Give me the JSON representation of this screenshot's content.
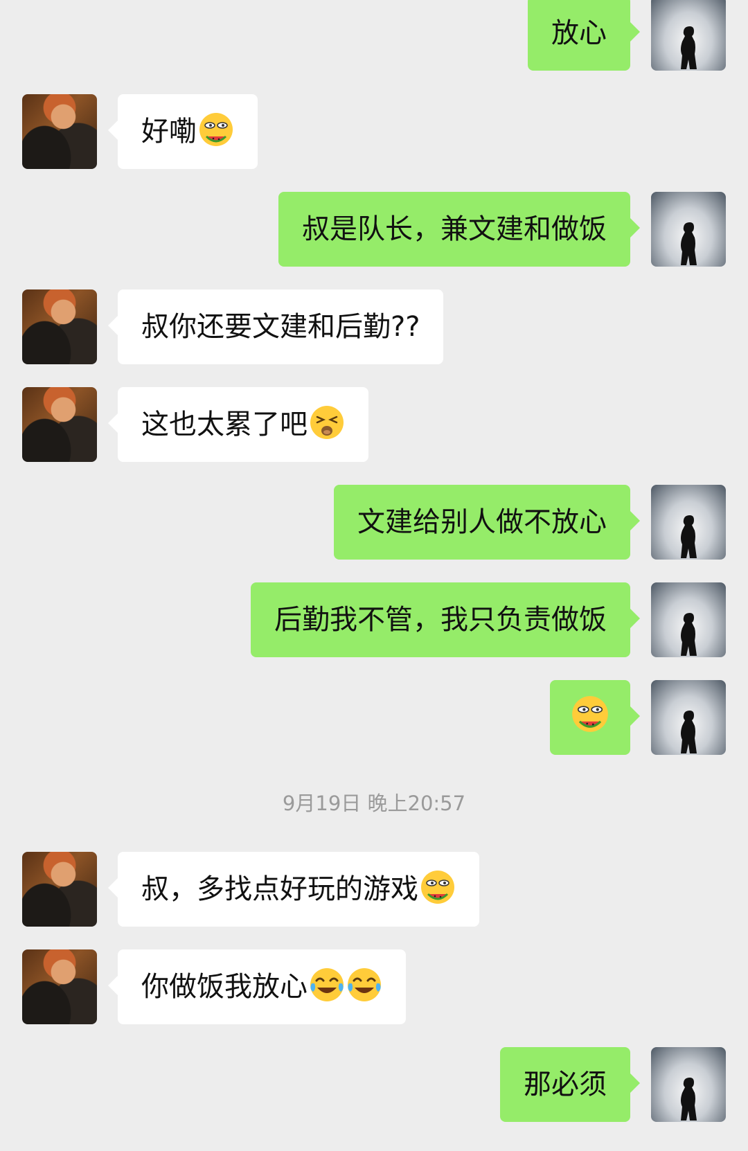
{
  "app": "WeChat chat",
  "colors": {
    "background": "#ededed",
    "self_bubble": "#95ec69",
    "friend_bubble": "#ffffff",
    "timestamp_text": "#9a9a9a"
  },
  "timestamp": "9月19日 晚上20:57",
  "messages": [
    {
      "sender": "self",
      "text": "放心",
      "emojis": []
    },
    {
      "sender": "friend",
      "text": "好嘞",
      "emojis": [
        "watermelon-eating-face-emoji"
      ]
    },
    {
      "sender": "self",
      "text": "叔是队长，兼文建和做饭",
      "emojis": []
    },
    {
      "sender": "friend",
      "text": "叔你还要文建和后勤??",
      "emojis": []
    },
    {
      "sender": "friend",
      "text": "这也太累了吧",
      "emojis": [
        "tired-face-emoji"
      ]
    },
    {
      "sender": "self",
      "text": "文建给别人做不放心",
      "emojis": []
    },
    {
      "sender": "self",
      "text": "后勤我不管，我只负责做饭",
      "emojis": []
    },
    {
      "sender": "self",
      "text": "",
      "emojis": [
        "watermelon-eating-face-emoji"
      ]
    },
    {
      "sender": "friend",
      "text": "叔，多找点好玩的游戏",
      "emojis": [
        "watermelon-eating-face-emoji"
      ]
    },
    {
      "sender": "friend",
      "text": "你做饭我放心",
      "emojis": [
        "tears-of-joy-emoji",
        "tears-of-joy-emoji"
      ]
    },
    {
      "sender": "self",
      "text": "那必须",
      "emojis": []
    }
  ]
}
